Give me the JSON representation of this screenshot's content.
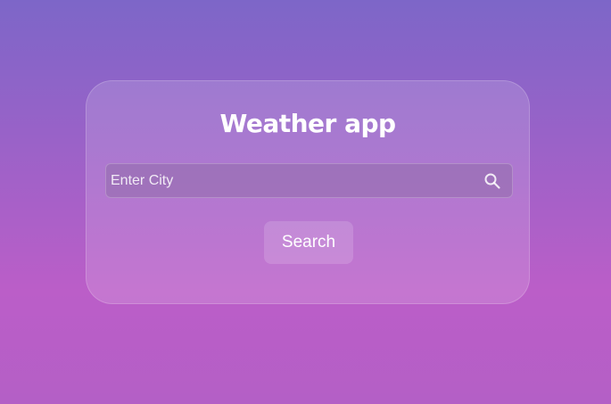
{
  "app": {
    "title": "Weather app"
  },
  "search": {
    "placeholder": "Enter City",
    "value": "",
    "icon": "search-icon",
    "button_label": "Search"
  },
  "colors": {
    "background_top": "#7d66c8",
    "background_bottom": "#bb5ec8",
    "text": "#ffffff"
  }
}
